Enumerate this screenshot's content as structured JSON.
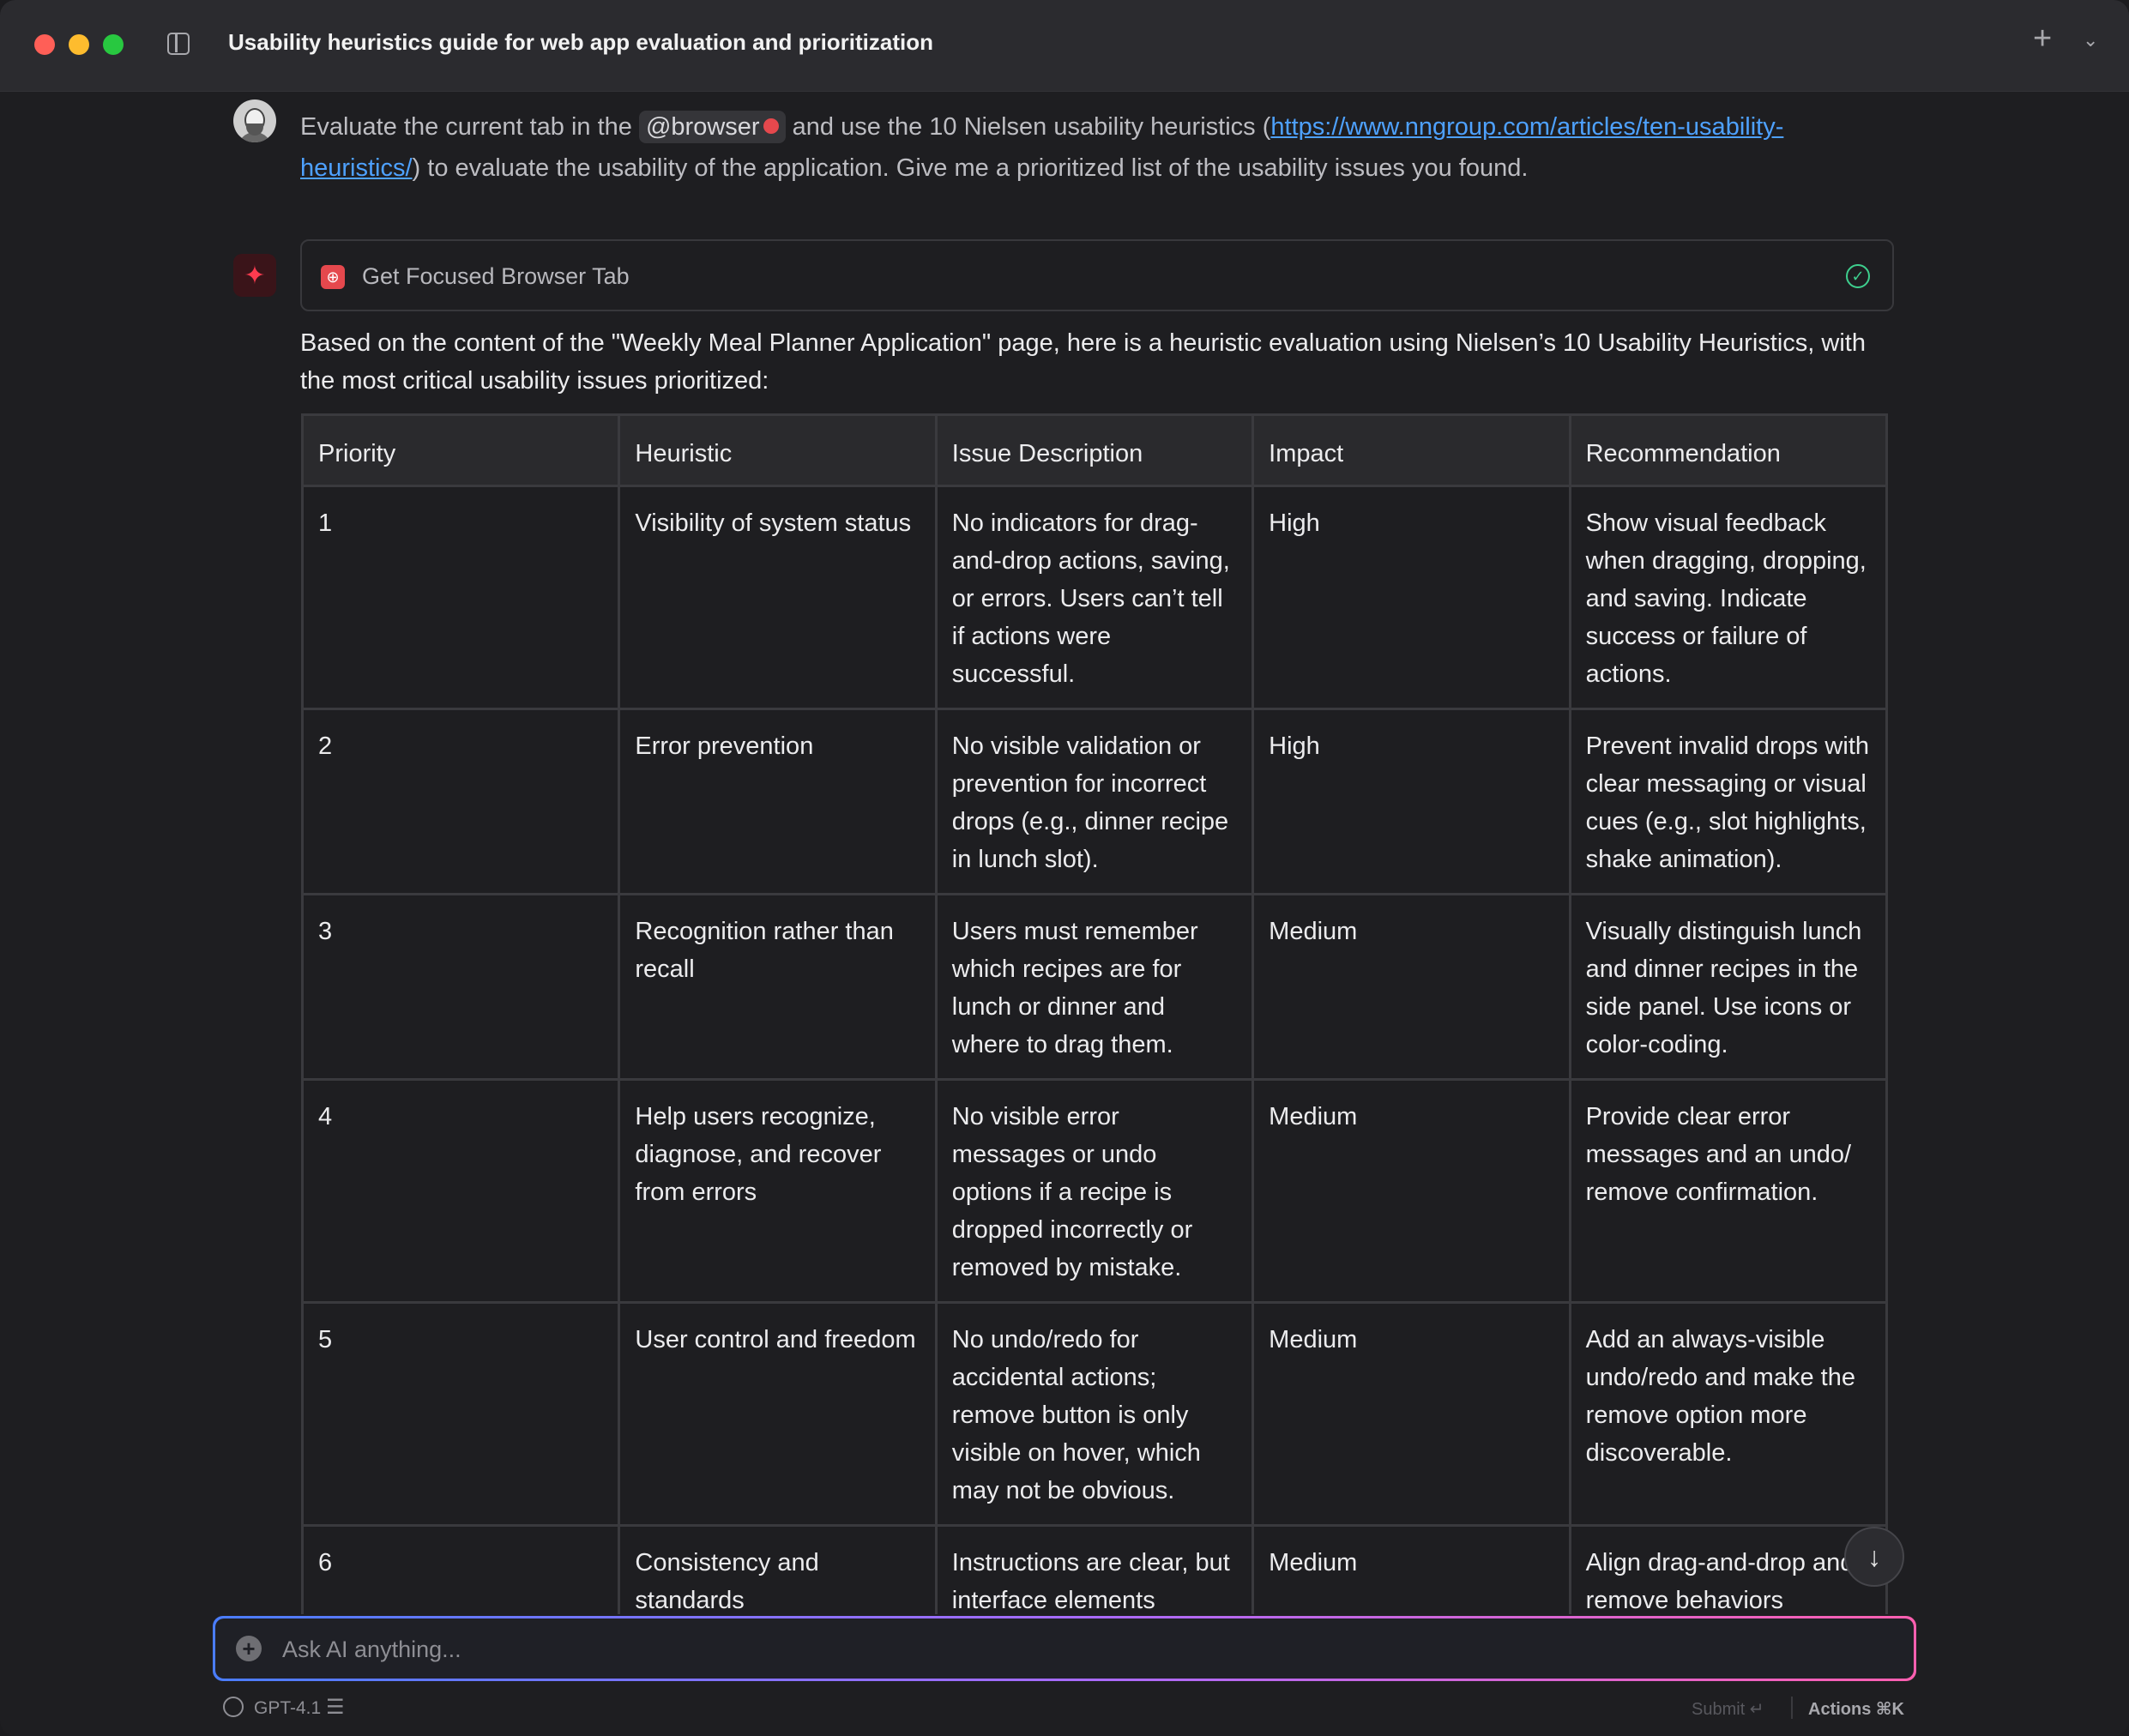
{
  "window": {
    "title": "Usability heuristics guide for web app evaluation and prioritization",
    "plus_icon": "+",
    "chevron_icon": "⌄"
  },
  "user_message": {
    "before_mention": "Evaluate the current tab in the ",
    "mention": "@browser",
    "middle": " and use the 10 Nielsen usability heuristics (",
    "link": "https://www.nngroup.com/articles/ten-usability-heuristics/",
    "after_link": ") to evaluate the usability of the application. Give me a prioritized list of the usability issues you found."
  },
  "assistant": {
    "tool_call": {
      "label": "Get Focused Browser Tab",
      "status": "completed"
    },
    "intro": "Based on the content of the \"Weekly Meal Planner Application\" page, here is a heuristic evaluation using Nielsen’s 10 Usability Heuristics, with the most critical usability issues prioritized:",
    "table": {
      "headers": [
        "Priority",
        "Heuristic",
        "Issue Description",
        "Impact",
        "Recommendation"
      ],
      "rows": [
        [
          "1",
          "Visibility of system status",
          "No indicators for drag-and-drop actions, saving, or errors. Users can’t tell if actions were successful.",
          "High",
          "Show visual feedback when dragging, dropping, and saving. Indicate success or failure of actions."
        ],
        [
          "2",
          "Error prevention",
          "No visible validation or prevention for incorrect drops (e.g., dinner recipe in lunch slot).",
          "High",
          "Prevent invalid drops with clear messaging or visual cues (e.g., slot highlights, shake animation)."
        ],
        [
          "3",
          "Recognition rather than recall",
          "Users must remember which recipes are for lunch or dinner and where to drag them.",
          "Medium",
          "Visually distinguish lunch and dinner recipes in the side panel. Use icons or color-coding."
        ],
        [
          "4",
          "Help users recognize, diagnose, and recover from errors",
          "No visible error messages or undo options if a recipe is dropped incorrectly or removed by mistake.",
          "Medium",
          "Provide clear error messages and an undo/ remove confirmation."
        ],
        [
          "5",
          "User control and freedom",
          "No undo/redo for accidental actions; remove button is only visible on hover, which may not be obvious.",
          "Medium",
          "Add an always-visible undo/redo and make the remove option more discoverable."
        ],
        [
          "6",
          "Consistency and standards",
          "Instructions are clear, but interface elements",
          "Medium",
          "Align drag-and-drop and remove behaviors"
        ]
      ]
    }
  },
  "input": {
    "placeholder": "Ask AI anything..."
  },
  "footer": {
    "model": "GPT-4.1",
    "submit": "Submit ↵",
    "actions": "Actions ⌘K"
  }
}
